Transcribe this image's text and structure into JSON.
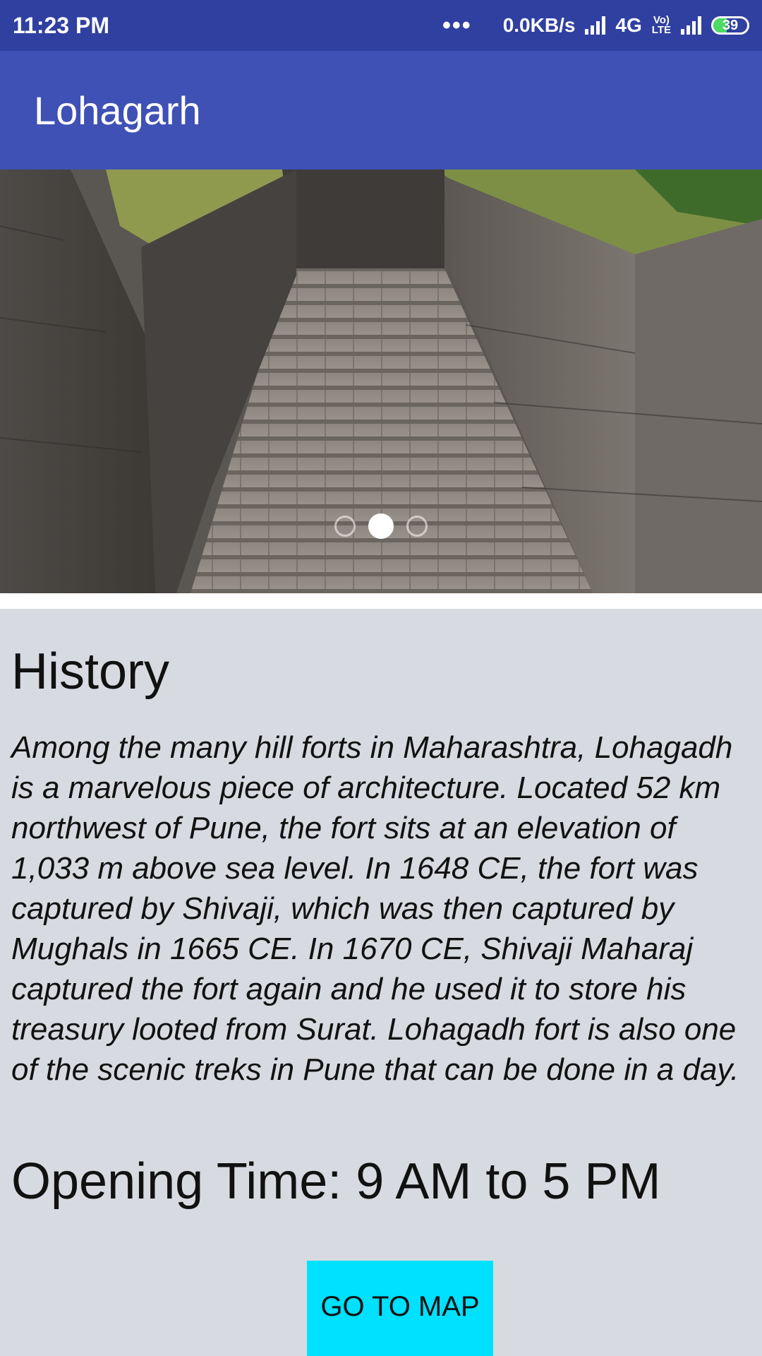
{
  "status_bar": {
    "time": "11:23 PM",
    "dots": "•••",
    "speed": "0.0KB/s",
    "network": "4G",
    "volte": "Vo) LTE",
    "battery": "39"
  },
  "app_bar": {
    "title": "Lohagarh"
  },
  "carousel": {
    "indicator_count": 3,
    "active_index": 1
  },
  "content": {
    "history_title": "History",
    "history_text": "Among the many hill forts in Maharashtra, Lohagadh is a marvelous piece of architecture. Located 52 km northwest of Pune, the fort sits at an elevation of 1,033 m above sea level. In 1648 CE, the fort was captured by Shivaji, which was then captured by Mughals in 1665 CE. In 1670 CE, Shivaji Maharaj captured the fort again and he used it to store his treasury looted from Surat. Lohagadh fort is also one of the scenic treks in Pune that can be done in a day.",
    "opening_time": "Opening Time: 9 AM to 5 PM",
    "map_button": "GO TO MAP"
  },
  "colors": {
    "status_bar": "#3040a0",
    "app_bar": "#3f51b5",
    "card_bg": "#d8dae1",
    "button_bg": "#00e0ff"
  }
}
